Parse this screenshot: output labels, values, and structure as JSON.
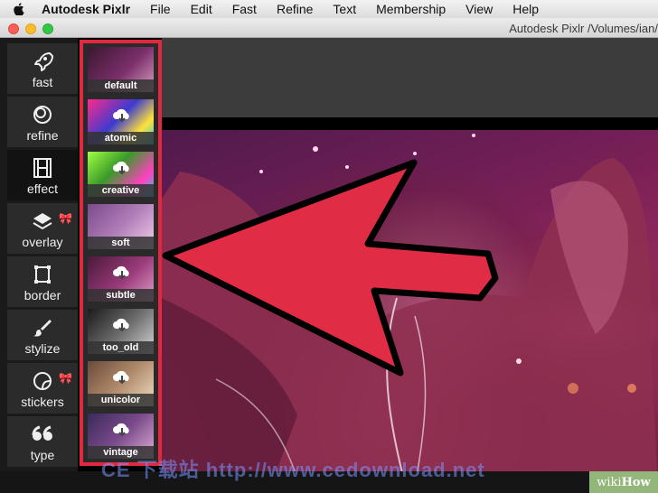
{
  "menubar": {
    "app_name": "Autodesk Pixlr",
    "items": [
      "File",
      "Edit",
      "Fast",
      "Refine",
      "Text",
      "Membership",
      "View",
      "Help"
    ]
  },
  "window": {
    "title": "Autodesk Pixlr   /Volumes/ian/"
  },
  "tools": [
    {
      "label": "fast",
      "icon": "rocket-icon",
      "active": false,
      "pro": false
    },
    {
      "label": "refine",
      "icon": "refine-circles-icon",
      "active": false,
      "pro": false
    },
    {
      "label": "effect",
      "icon": "film-strip-icon",
      "active": true,
      "pro": false
    },
    {
      "label": "overlay",
      "icon": "layers-icon",
      "active": false,
      "pro": true
    },
    {
      "label": "border",
      "icon": "border-frame-icon",
      "active": false,
      "pro": false
    },
    {
      "label": "stylize",
      "icon": "brush-icon",
      "active": false,
      "pro": false
    },
    {
      "label": "stickers",
      "icon": "sticker-icon",
      "active": false,
      "pro": true
    },
    {
      "label": "type",
      "icon": "quote-icon",
      "active": false,
      "pro": false
    }
  ],
  "pro_badge_icon": "ribbon-icon",
  "effects": [
    {
      "label": "default",
      "download": false,
      "tint": "#7a2e6a"
    },
    {
      "label": "atomic",
      "download": true,
      "tint": "#3b3bd0"
    },
    {
      "label": "creative",
      "download": true,
      "tint": "#3a9a2a"
    },
    {
      "label": "soft",
      "download": false,
      "tint": "#b07cb8"
    },
    {
      "label": "subtle",
      "download": true,
      "tint": "#9a3a7a"
    },
    {
      "label": "too_old",
      "download": true,
      "tint": "#6a6a6a"
    },
    {
      "label": "unicolor",
      "download": true,
      "tint": "#b08a6a"
    },
    {
      "label": "vintage",
      "download": true,
      "tint": "#7a4a8a"
    }
  ],
  "colors": {
    "highlight_red": "#e2283f",
    "arrow_red": "#e02c44"
  },
  "watermark": "CE 下载站  http://www.cedownload.net",
  "badge": {
    "wiki": "wiki",
    "how": "How"
  }
}
